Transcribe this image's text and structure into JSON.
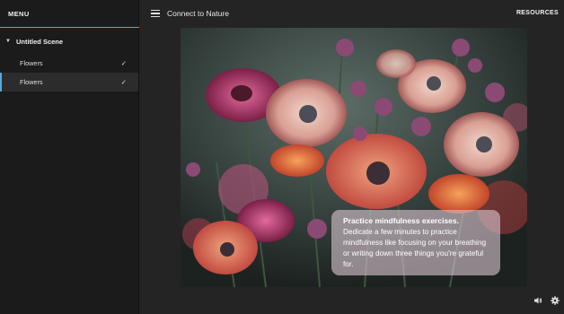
{
  "menu": {
    "title": "MENU",
    "scene": {
      "label": "Untitled Scene"
    },
    "items": [
      {
        "label": "Flowers",
        "check": "✓"
      },
      {
        "label": "Flowers",
        "check": "✓"
      }
    ]
  },
  "header": {
    "title": "Connect to Nature",
    "resources_label": "RESOURCES"
  },
  "caption": {
    "heading": "Practice mindfulness exercises.",
    "body": "Dedicate a few minutes to practice mindfulness like focusing on your breathing or writing down three things you're grateful for."
  },
  "icons": {
    "menu": "hamburger-icon",
    "volume": "volume-icon",
    "settings": "gear-icon"
  },
  "colors": {
    "accent": "#5ba7d6",
    "sidebar_bg": "#1b1b1b",
    "main_bg": "#242424"
  }
}
